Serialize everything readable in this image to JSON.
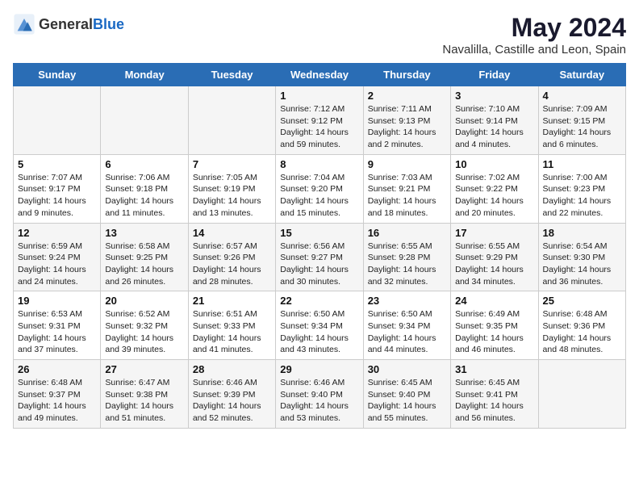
{
  "header": {
    "logo_general": "General",
    "logo_blue": "Blue",
    "title": "May 2024",
    "subtitle": "Navalilla, Castille and Leon, Spain"
  },
  "days_of_week": [
    "Sunday",
    "Monday",
    "Tuesday",
    "Wednesday",
    "Thursday",
    "Friday",
    "Saturday"
  ],
  "weeks": [
    [
      {
        "day": "",
        "sunrise": "",
        "sunset": "",
        "daylight": ""
      },
      {
        "day": "",
        "sunrise": "",
        "sunset": "",
        "daylight": ""
      },
      {
        "day": "",
        "sunrise": "",
        "sunset": "",
        "daylight": ""
      },
      {
        "day": "1",
        "sunrise": "Sunrise: 7:12 AM",
        "sunset": "Sunset: 9:12 PM",
        "daylight": "Daylight: 14 hours and 59 minutes."
      },
      {
        "day": "2",
        "sunrise": "Sunrise: 7:11 AM",
        "sunset": "Sunset: 9:13 PM",
        "daylight": "Daylight: 14 hours and 2 minutes."
      },
      {
        "day": "3",
        "sunrise": "Sunrise: 7:10 AM",
        "sunset": "Sunset: 9:14 PM",
        "daylight": "Daylight: 14 hours and 4 minutes."
      },
      {
        "day": "4",
        "sunrise": "Sunrise: 7:09 AM",
        "sunset": "Sunset: 9:15 PM",
        "daylight": "Daylight: 14 hours and 6 minutes."
      }
    ],
    [
      {
        "day": "5",
        "sunrise": "Sunrise: 7:07 AM",
        "sunset": "Sunset: 9:17 PM",
        "daylight": "Daylight: 14 hours and 9 minutes."
      },
      {
        "day": "6",
        "sunrise": "Sunrise: 7:06 AM",
        "sunset": "Sunset: 9:18 PM",
        "daylight": "Daylight: 14 hours and 11 minutes."
      },
      {
        "day": "7",
        "sunrise": "Sunrise: 7:05 AM",
        "sunset": "Sunset: 9:19 PM",
        "daylight": "Daylight: 14 hours and 13 minutes."
      },
      {
        "day": "8",
        "sunrise": "Sunrise: 7:04 AM",
        "sunset": "Sunset: 9:20 PM",
        "daylight": "Daylight: 14 hours and 15 minutes."
      },
      {
        "day": "9",
        "sunrise": "Sunrise: 7:03 AM",
        "sunset": "Sunset: 9:21 PM",
        "daylight": "Daylight: 14 hours and 18 minutes."
      },
      {
        "day": "10",
        "sunrise": "Sunrise: 7:02 AM",
        "sunset": "Sunset: 9:22 PM",
        "daylight": "Daylight: 14 hours and 20 minutes."
      },
      {
        "day": "11",
        "sunrise": "Sunrise: 7:00 AM",
        "sunset": "Sunset: 9:23 PM",
        "daylight": "Daylight: 14 hours and 22 minutes."
      }
    ],
    [
      {
        "day": "12",
        "sunrise": "Sunrise: 6:59 AM",
        "sunset": "Sunset: 9:24 PM",
        "daylight": "Daylight: 14 hours and 24 minutes."
      },
      {
        "day": "13",
        "sunrise": "Sunrise: 6:58 AM",
        "sunset": "Sunset: 9:25 PM",
        "daylight": "Daylight: 14 hours and 26 minutes."
      },
      {
        "day": "14",
        "sunrise": "Sunrise: 6:57 AM",
        "sunset": "Sunset: 9:26 PM",
        "daylight": "Daylight: 14 hours and 28 minutes."
      },
      {
        "day": "15",
        "sunrise": "Sunrise: 6:56 AM",
        "sunset": "Sunset: 9:27 PM",
        "daylight": "Daylight: 14 hours and 30 minutes."
      },
      {
        "day": "16",
        "sunrise": "Sunrise: 6:55 AM",
        "sunset": "Sunset: 9:28 PM",
        "daylight": "Daylight: 14 hours and 32 minutes."
      },
      {
        "day": "17",
        "sunrise": "Sunrise: 6:55 AM",
        "sunset": "Sunset: 9:29 PM",
        "daylight": "Daylight: 14 hours and 34 minutes."
      },
      {
        "day": "18",
        "sunrise": "Sunrise: 6:54 AM",
        "sunset": "Sunset: 9:30 PM",
        "daylight": "Daylight: 14 hours and 36 minutes."
      }
    ],
    [
      {
        "day": "19",
        "sunrise": "Sunrise: 6:53 AM",
        "sunset": "Sunset: 9:31 PM",
        "daylight": "Daylight: 14 hours and 37 minutes."
      },
      {
        "day": "20",
        "sunrise": "Sunrise: 6:52 AM",
        "sunset": "Sunset: 9:32 PM",
        "daylight": "Daylight: 14 hours and 39 minutes."
      },
      {
        "day": "21",
        "sunrise": "Sunrise: 6:51 AM",
        "sunset": "Sunset: 9:33 PM",
        "daylight": "Daylight: 14 hours and 41 minutes."
      },
      {
        "day": "22",
        "sunrise": "Sunrise: 6:50 AM",
        "sunset": "Sunset: 9:34 PM",
        "daylight": "Daylight: 14 hours and 43 minutes."
      },
      {
        "day": "23",
        "sunrise": "Sunrise: 6:50 AM",
        "sunset": "Sunset: 9:34 PM",
        "daylight": "Daylight: 14 hours and 44 minutes."
      },
      {
        "day": "24",
        "sunrise": "Sunrise: 6:49 AM",
        "sunset": "Sunset: 9:35 PM",
        "daylight": "Daylight: 14 hours and 46 minutes."
      },
      {
        "day": "25",
        "sunrise": "Sunrise: 6:48 AM",
        "sunset": "Sunset: 9:36 PM",
        "daylight": "Daylight: 14 hours and 48 minutes."
      }
    ],
    [
      {
        "day": "26",
        "sunrise": "Sunrise: 6:48 AM",
        "sunset": "Sunset: 9:37 PM",
        "daylight": "Daylight: 14 hours and 49 minutes."
      },
      {
        "day": "27",
        "sunrise": "Sunrise: 6:47 AM",
        "sunset": "Sunset: 9:38 PM",
        "daylight": "Daylight: 14 hours and 51 minutes."
      },
      {
        "day": "28",
        "sunrise": "Sunrise: 6:46 AM",
        "sunset": "Sunset: 9:39 PM",
        "daylight": "Daylight: 14 hours and 52 minutes."
      },
      {
        "day": "29",
        "sunrise": "Sunrise: 6:46 AM",
        "sunset": "Sunset: 9:40 PM",
        "daylight": "Daylight: 14 hours and 53 minutes."
      },
      {
        "day": "30",
        "sunrise": "Sunrise: 6:45 AM",
        "sunset": "Sunset: 9:40 PM",
        "daylight": "Daylight: 14 hours and 55 minutes."
      },
      {
        "day": "31",
        "sunrise": "Sunrise: 6:45 AM",
        "sunset": "Sunset: 9:41 PM",
        "daylight": "Daylight: 14 hours and 56 minutes."
      },
      {
        "day": "",
        "sunrise": "",
        "sunset": "",
        "daylight": ""
      }
    ]
  ]
}
